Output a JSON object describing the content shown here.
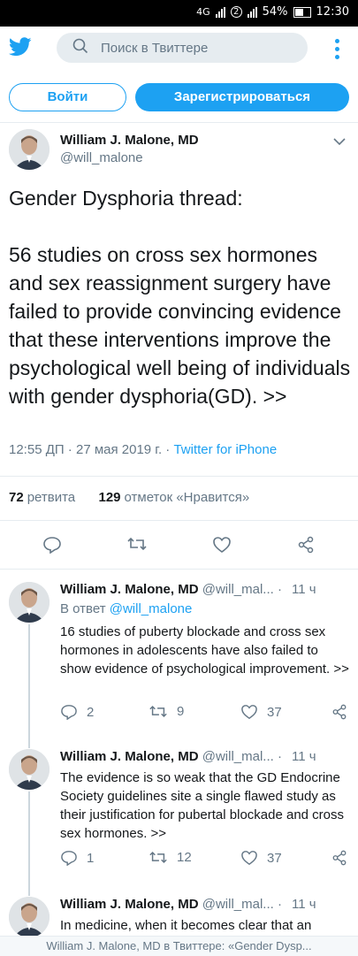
{
  "status_bar": {
    "network": "4G",
    "sim_badge": "2",
    "battery": "54%",
    "time": "12:30"
  },
  "search": {
    "placeholder": "Поиск в Твиттере"
  },
  "auth": {
    "login_label": "Войти",
    "signup_label": "Зарегистрироваться"
  },
  "main_tweet": {
    "author_name": "William J. Malone, MD",
    "handle": "@will_malone",
    "text": "Gender Dysphoria thread:\n\n56 studies on cross sex hormones and sex reassignment surgery have failed to provide convincing evidence that these interventions improve the psychological well being of individuals with gender dysphoria(GD). >>",
    "timestamp": "12:55 ДП · 27 мая 2019 г. · ",
    "source": "Twitter for iPhone",
    "retweets_count": "72",
    "retweets_label": "ретвита",
    "likes_count": "129",
    "likes_label": "отметок «Нравится»"
  },
  "replies": [
    {
      "author_name": "William J. Malone, MD",
      "handle": "@will_mal... ·",
      "time": "11 ч",
      "reply_prefix": "В ответ",
      "reply_to": "@will_malone",
      "text": "16 studies of puberty blockade and cross sex hormones in adolescents have also failed to show evidence of psychological improvement. >>",
      "replies": "2",
      "retweets": "9",
      "likes": "37"
    },
    {
      "author_name": "William J. Malone, MD",
      "handle": "@will_mal... ·",
      "time": "11 ч",
      "text": "The evidence is so weak that the GD Endocrine Society guidelines site a single flawed study as their justification for pubertal blockade and cross sex hormones. >>",
      "replies": "1",
      "retweets": "12",
      "likes": "37"
    },
    {
      "author_name": "William J. Malone, MD",
      "handle": "@will_mal... ·",
      "time": "11 ч",
      "text": "In medicine, when it becomes clear that an"
    }
  ],
  "bottom_bar": {
    "title": "William J. Malone, MD в Твиттере: «Gender Dysp..."
  },
  "colors": {
    "accent": "#1da1f2",
    "muted": "#657786",
    "text": "#14171a"
  },
  "icons": [
    "twitter-bird-icon",
    "search-icon",
    "more-vertical-icon",
    "chevron-down-icon",
    "reply-icon",
    "retweet-icon",
    "like-icon",
    "share-icon"
  ]
}
